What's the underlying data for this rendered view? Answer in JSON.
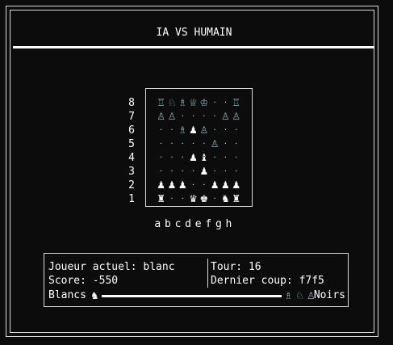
{
  "title": "IA VS HUMAIN",
  "ranks": [
    "8",
    "7",
    "6",
    "5",
    "4",
    "3",
    "2",
    "1"
  ],
  "files": [
    "a",
    "b",
    "c",
    "d",
    "e",
    "f",
    "g",
    "h"
  ],
  "board": [
    [
      "bR",
      "bN",
      "bB",
      "bQ",
      "bK",
      ".",
      ".",
      "bR"
    ],
    [
      "bP",
      "bP",
      ".",
      ".",
      ".",
      ".",
      "bP",
      "bP"
    ],
    [
      ".",
      ".",
      "bB",
      "wP",
      "bP",
      ".",
      ".",
      "."
    ],
    [
      ".",
      ".",
      ".",
      ".",
      ".",
      "bP",
      ".",
      "."
    ],
    [
      ".",
      ".",
      ".",
      "wP",
      "wB",
      ".",
      ".",
      "."
    ],
    [
      ".",
      ".",
      ".",
      ".",
      "wP",
      ".",
      ".",
      "."
    ],
    [
      "wP",
      "wP",
      "wP",
      ".",
      ".",
      "wP",
      "wP",
      "wP"
    ],
    [
      "wR",
      ".",
      ".",
      "wQ",
      "wK",
      ".",
      "wN",
      "wR"
    ]
  ],
  "status": {
    "current_player": "Joueur actuel: blanc",
    "turn": "Tour: 16",
    "score": "Score: -550",
    "last_move": "Dernier coup: f7f5",
    "white_label": "Blancs",
    "black_label": "Noirs",
    "white_captured_icons": [
      "knight-icon"
    ],
    "black_captured_icons": [
      "bishop-icon",
      "knight-icon",
      "pawn-icon"
    ],
    "balance_white_share": 1.0
  },
  "colors": {
    "white_piece": "#ffffff",
    "black_piece": "#7fb9c2",
    "background": "#0c0c0c"
  }
}
